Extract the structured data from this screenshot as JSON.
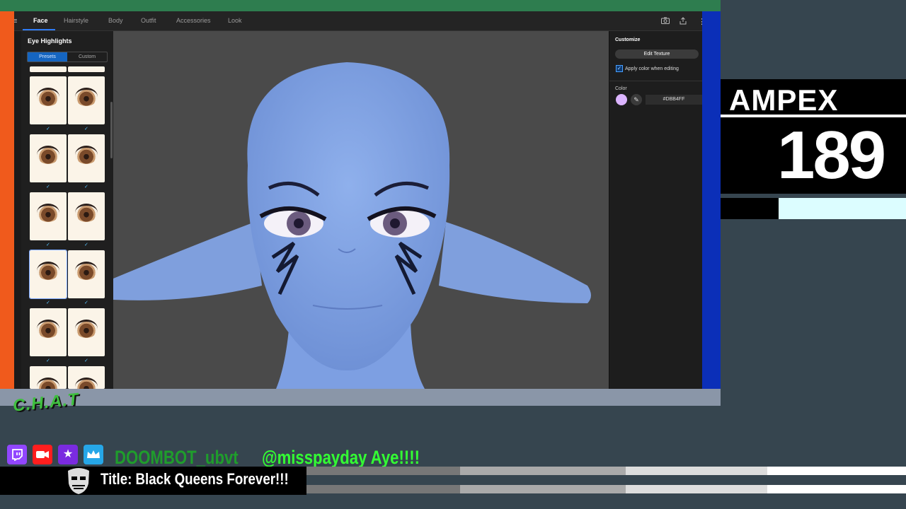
{
  "app": {
    "tabs": [
      {
        "label": "Face",
        "active": true
      },
      {
        "label": "Hairstyle",
        "active": false
      },
      {
        "label": "Body",
        "active": false
      },
      {
        "label": "Outfit",
        "active": false
      },
      {
        "label": "Accessories",
        "active": false
      },
      {
        "label": "Look",
        "active": false
      }
    ],
    "toolbar_icons": [
      "camera-icon",
      "share-icon",
      "more-icon"
    ]
  },
  "left_panel": {
    "title": "Eye Highlights",
    "segments": [
      {
        "label": "Presets",
        "active": true
      },
      {
        "label": "Custom",
        "active": false
      }
    ],
    "check_mark": "✓"
  },
  "right_panel": {
    "title": "Customize",
    "edit_button": "Edit Texture",
    "checkbox_mark": "✓",
    "checkbox_label": "Apply color when editing",
    "checkbox_checked": true,
    "color_label": "Color",
    "color_value": "#DBB4FF",
    "picker_glyph": "✎"
  },
  "overlay": {
    "ampex_word": "AMPEX",
    "ampex_number": "189",
    "chat_logo": "C.H.A.T",
    "platform_icons": [
      "twitch-icon",
      "youtube-icon",
      "star-icon",
      "crown-icon"
    ],
    "chat_username": "DOOMBOT_ubvt",
    "chat_message": "@misspayday Aye!!!!",
    "stream_title": "Title: Black Queens Forever!!!"
  },
  "colors": {
    "accent": "#2f7cf6",
    "top_strip": "#2e7d4f",
    "left_strip": "#f05a1c",
    "right_strip": "#0b2fb8",
    "chat_green": "#33ff33",
    "swatch": "#dbb4ff"
  }
}
